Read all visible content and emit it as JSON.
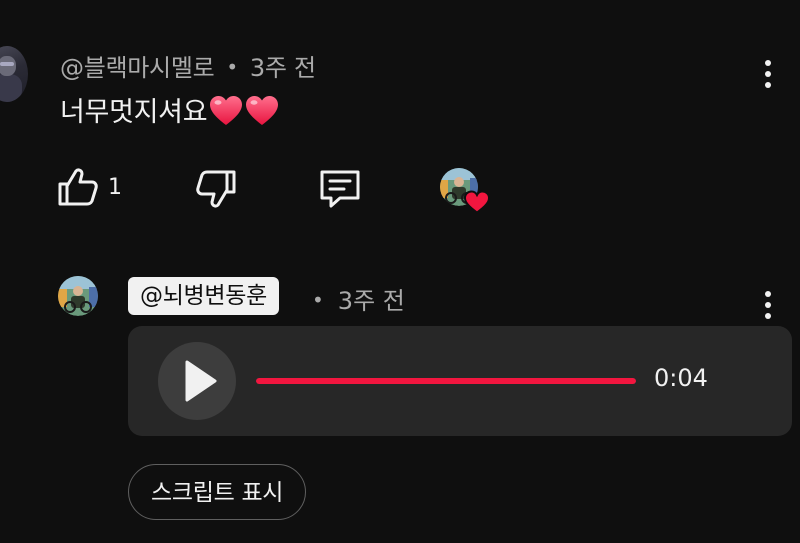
{
  "comment": {
    "author": "@블랙마시멜로",
    "separator": "•",
    "time": "3주 전",
    "text": "너무멋지셔요",
    "emoji_icons": [
      "red-heart-icon",
      "red-heart-icon"
    ],
    "like_count": "1",
    "icons": {
      "like": "thumbs-up-icon",
      "dislike": "thumbs-down-icon",
      "reply": "comment-icon",
      "more": "kebab-menu-icon",
      "creator_heart": "creator-heart-icon"
    }
  },
  "reply": {
    "author_mention": "@뇌병변동훈",
    "separator": "•",
    "time": "3주 전",
    "voice": {
      "duration": "0:04",
      "progress": 1.0
    },
    "transcript_label": "스크립트 표시"
  },
  "colors": {
    "background": "#0f0f0f",
    "accent_red": "#f2163f",
    "secondary_text": "#aaaaaa",
    "player_bg": "#272727"
  }
}
